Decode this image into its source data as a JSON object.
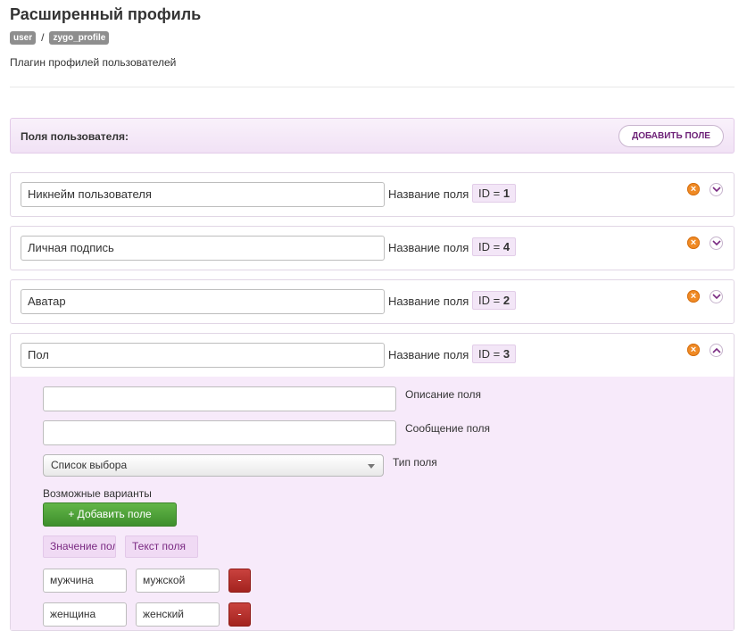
{
  "header": {
    "title": "Расширенный профиль",
    "breadcrumb": [
      "user",
      "zygo_profile"
    ],
    "breadcrumb_separator": "/",
    "subtitle": "Плагин профилей пользователей"
  },
  "fields_section": {
    "label": "Поля пользователя:",
    "add_button": "ДОБАВИТЬ ПОЛЕ"
  },
  "field_name_label": "Название поля",
  "fields": [
    {
      "name": "Никнейм пользователя",
      "id_label": "ID =",
      "id": "1",
      "expanded": false
    },
    {
      "name": "Личная подпись",
      "id_label": "ID =",
      "id": "4",
      "expanded": false
    },
    {
      "name": "Аватар",
      "id_label": "ID =",
      "id": "2",
      "expanded": false
    },
    {
      "name": "Пол",
      "id_label": "ID =",
      "id": "3",
      "expanded": true
    }
  ],
  "expanded_panel": {
    "description_value": "",
    "description_label": "Описание поля",
    "message_value": "",
    "message_label": "Сообщение поля",
    "type_selected": "Список выбора",
    "type_label": "Тип поля",
    "options_label": "Возможные варианты",
    "add_option_button": "+ Добавить поле",
    "columns": [
      "Значение поля",
      "Текст поля"
    ],
    "options": [
      {
        "value": "мужчина",
        "text": "мужской",
        "remove": "-"
      },
      {
        "value": "женщина",
        "text": "женский",
        "remove": "-"
      }
    ]
  },
  "colors": {
    "accent": "#6d2177",
    "panel_bg": "#f7eafa",
    "success": "#4ea33a",
    "danger": "#b52e2a",
    "delete_icon": "#f08a24"
  },
  "icons": {
    "delete": "delete-icon",
    "collapse": "chevron-down-icon",
    "expand": "chevron-up-icon"
  }
}
